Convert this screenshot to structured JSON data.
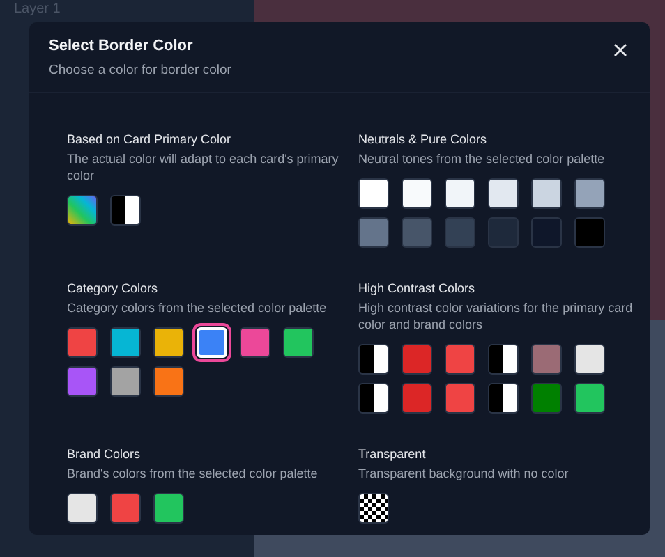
{
  "backdrop": {
    "label": "Layer 1"
  },
  "dialog": {
    "title": "Select Border Color",
    "subtitle": "Choose a color for border color"
  },
  "sections": [
    {
      "title": "Based on Card Primary Color",
      "description": "The actual color will adapt to each card's primary color",
      "swatches": [
        {
          "kind": "gradient",
          "selected": false
        },
        {
          "kind": "split",
          "selected": false
        }
      ]
    },
    {
      "title": "Neutrals & Pure Colors",
      "description": "Neutral tones from the selected color palette",
      "swatches": [
        {
          "kind": "solid",
          "color": "#ffffff",
          "selected": false
        },
        {
          "kind": "solid",
          "color": "#f8fafc",
          "selected": false
        },
        {
          "kind": "solid",
          "color": "#f1f5f9",
          "selected": false
        },
        {
          "kind": "solid",
          "color": "#e2e8f0",
          "selected": false
        },
        {
          "kind": "solid",
          "color": "#cbd5e1",
          "selected": false
        },
        {
          "kind": "solid",
          "color": "#94a3b8",
          "selected": false
        },
        {
          "kind": "solid",
          "color": "#64748b",
          "selected": false
        },
        {
          "kind": "solid",
          "color": "#475569",
          "selected": false
        },
        {
          "kind": "solid",
          "color": "#334155",
          "selected": false
        },
        {
          "kind": "solid",
          "color": "#1e293b",
          "selected": false
        },
        {
          "kind": "solid",
          "color": "#0f172a",
          "selected": false
        },
        {
          "kind": "solid",
          "color": "#000000",
          "selected": false
        }
      ]
    },
    {
      "title": "Category Colors",
      "description": "Category colors from the selected color palette",
      "swatches": [
        {
          "kind": "solid",
          "color": "#ef4444",
          "selected": false
        },
        {
          "kind": "solid",
          "color": "#06b6d4",
          "selected": false
        },
        {
          "kind": "solid",
          "color": "#eab308",
          "selected": false
        },
        {
          "kind": "solid",
          "color": "#3b82f6",
          "selected": true
        },
        {
          "kind": "solid",
          "color": "#ec4899",
          "selected": false
        },
        {
          "kind": "solid",
          "color": "#22c55e",
          "selected": false
        },
        {
          "kind": "solid",
          "color": "#a855f7",
          "selected": false
        },
        {
          "kind": "solid",
          "color": "#a3a3a3",
          "selected": false
        },
        {
          "kind": "solid",
          "color": "#f97316",
          "selected": false
        }
      ]
    },
    {
      "title": "High Contrast Colors",
      "description": "High contrast color variations for the primary card color and brand colors",
      "swatches": [
        {
          "kind": "split",
          "selected": false
        },
        {
          "kind": "solid",
          "color": "#dc2626",
          "selected": false
        },
        {
          "kind": "solid",
          "color": "#ef4444",
          "selected": false
        },
        {
          "kind": "split",
          "selected": false
        },
        {
          "kind": "solid",
          "color": "#9b6b75",
          "selected": false
        },
        {
          "kind": "solid",
          "color": "#e5e5e5",
          "selected": false
        },
        {
          "kind": "split",
          "selected": false
        },
        {
          "kind": "solid",
          "color": "#dc2626",
          "selected": false
        },
        {
          "kind": "solid",
          "color": "#ef4444",
          "selected": false
        },
        {
          "kind": "split",
          "selected": false
        },
        {
          "kind": "solid",
          "color": "#008000",
          "selected": false
        },
        {
          "kind": "solid",
          "color": "#22c55e",
          "selected": false
        }
      ]
    },
    {
      "title": "Brand Colors",
      "description": "Brand's colors from the selected color palette",
      "swatches": [
        {
          "kind": "solid",
          "color": "#e5e5e5",
          "selected": false
        },
        {
          "kind": "solid",
          "color": "#ef4444",
          "selected": false
        },
        {
          "kind": "solid",
          "color": "#22c55e",
          "selected": false
        }
      ]
    },
    {
      "title": "Transparent",
      "description": "Transparent background with no color",
      "swatches": [
        {
          "kind": "checker",
          "selected": false
        }
      ]
    }
  ]
}
